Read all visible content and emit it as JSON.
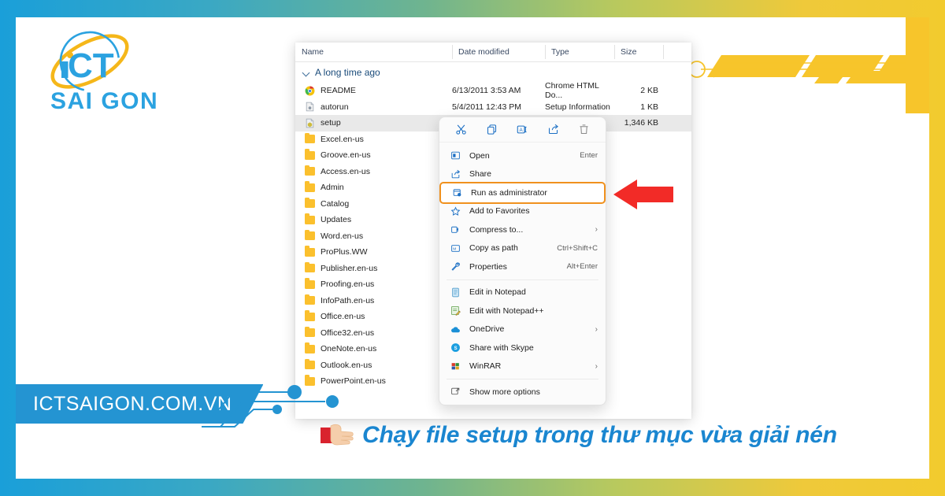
{
  "brand": {
    "logo_line1": "iCT",
    "logo_line2": "SAI GON",
    "url": "ICTSAIGON.COM.VN"
  },
  "caption": {
    "text": "Chạy file setup trong thư mục vừa giải nén",
    "hand_icon": "pointing-right-hand-icon",
    "color": "#1a86d0"
  },
  "colors": {
    "brand_blue": "#2494d2",
    "brand_yellow": "#f2cb2e",
    "highlight_orange": "#f0911e",
    "arrow_red": "#f02b2b",
    "folder_yellow": "#fbc02d"
  },
  "explorer": {
    "columns": [
      "Name",
      "Date modified",
      "Type",
      "Size"
    ],
    "group_header": "A long time ago",
    "rows": [
      {
        "name": "README",
        "icon": "chrome-icon",
        "date": "6/13/2011 3:53 AM",
        "type": "Chrome HTML Do...",
        "size": "2 KB",
        "selected": false
      },
      {
        "name": "autorun",
        "icon": "inf-file-icon",
        "date": "5/4/2011 12:43 PM",
        "type": "Setup Information",
        "size": "1 KB",
        "selected": false
      },
      {
        "name": "setup",
        "icon": "exe-file-icon",
        "date": "",
        "type": "",
        "size": "1,346 KB",
        "selected": true
      },
      {
        "name": "Excel.en-us",
        "icon": "folder-icon",
        "date": "",
        "type": "",
        "size": "",
        "selected": false
      },
      {
        "name": "Groove.en-us",
        "icon": "folder-icon",
        "date": "",
        "type": "",
        "size": "",
        "selected": false
      },
      {
        "name": "Access.en-us",
        "icon": "folder-icon",
        "date": "",
        "type": "",
        "size": "",
        "selected": false
      },
      {
        "name": "Admin",
        "icon": "folder-icon",
        "date": "",
        "type": "",
        "size": "",
        "selected": false
      },
      {
        "name": "Catalog",
        "icon": "folder-icon",
        "date": "",
        "type": "",
        "size": "",
        "selected": false
      },
      {
        "name": "Updates",
        "icon": "folder-icon",
        "date": "",
        "type": "",
        "size": "",
        "selected": false
      },
      {
        "name": "Word.en-us",
        "icon": "folder-icon",
        "date": "",
        "type": "",
        "size": "",
        "selected": false
      },
      {
        "name": "ProPlus.WW",
        "icon": "folder-icon",
        "date": "",
        "type": "",
        "size": "",
        "selected": false
      },
      {
        "name": "Publisher.en-us",
        "icon": "folder-icon",
        "date": "",
        "type": "",
        "size": "",
        "selected": false
      },
      {
        "name": "Proofing.en-us",
        "icon": "folder-icon",
        "date": "",
        "type": "",
        "size": "",
        "selected": false
      },
      {
        "name": "InfoPath.en-us",
        "icon": "folder-icon",
        "date": "",
        "type": "",
        "size": "",
        "selected": false
      },
      {
        "name": "Office.en-us",
        "icon": "folder-icon",
        "date": "",
        "type": "",
        "size": "",
        "selected": false
      },
      {
        "name": "Office32.en-us",
        "icon": "folder-icon",
        "date": "",
        "type": "",
        "size": "",
        "selected": false
      },
      {
        "name": "OneNote.en-us",
        "icon": "folder-icon",
        "date": "",
        "type": "",
        "size": "",
        "selected": false
      },
      {
        "name": "Outlook.en-us",
        "icon": "folder-icon",
        "date": "",
        "type": "",
        "size": "",
        "selected": false
      },
      {
        "name": "PowerPoint.en-us",
        "icon": "folder-icon",
        "date": "",
        "type": "",
        "size": "",
        "selected": false
      }
    ]
  },
  "context_menu": {
    "toolbar": [
      {
        "name": "cut-icon",
        "label": "Cut"
      },
      {
        "name": "copy-icon",
        "label": "Copy"
      },
      {
        "name": "rename-icon",
        "label": "Rename"
      },
      {
        "name": "share-icon",
        "label": "Share"
      },
      {
        "name": "delete-icon",
        "label": "Delete"
      }
    ],
    "groups": [
      [
        {
          "label": "Open",
          "accel": "Enter",
          "icon": "open-icon",
          "submenu": false,
          "highlight": false
        },
        {
          "label": "Share",
          "accel": "",
          "icon": "share-icon",
          "submenu": false,
          "highlight": false
        },
        {
          "label": "Run as administrator",
          "accel": "",
          "icon": "shield-run-icon",
          "submenu": false,
          "highlight": true
        },
        {
          "label": "Add to Favorites",
          "accel": "",
          "icon": "star-icon",
          "submenu": false,
          "highlight": false
        },
        {
          "label": "Compress to...",
          "accel": "",
          "icon": "compress-icon",
          "submenu": true,
          "highlight": false
        },
        {
          "label": "Copy as path",
          "accel": "Ctrl+Shift+C",
          "icon": "copy-path-icon",
          "submenu": false,
          "highlight": false
        },
        {
          "label": "Properties",
          "accel": "Alt+Enter",
          "icon": "wrench-icon",
          "submenu": false,
          "highlight": false
        }
      ],
      [
        {
          "label": "Edit in Notepad",
          "accel": "",
          "icon": "notepad-icon",
          "submenu": false,
          "highlight": false
        },
        {
          "label": "Edit with Notepad++",
          "accel": "",
          "icon": "notepadpp-icon",
          "submenu": false,
          "highlight": false
        },
        {
          "label": "OneDrive",
          "accel": "",
          "icon": "onedrive-icon",
          "submenu": true,
          "highlight": false
        },
        {
          "label": "Share with Skype",
          "accel": "",
          "icon": "skype-icon",
          "submenu": false,
          "highlight": false
        },
        {
          "label": "WinRAR",
          "accel": "",
          "icon": "winrar-icon",
          "submenu": true,
          "highlight": false
        }
      ],
      [
        {
          "label": "Show more options",
          "accel": "",
          "icon": "more-options-icon",
          "submenu": false,
          "highlight": false
        }
      ]
    ]
  },
  "annotation": {
    "arrow": "left-pointing-red-arrow",
    "points_to": "Run as administrator"
  }
}
